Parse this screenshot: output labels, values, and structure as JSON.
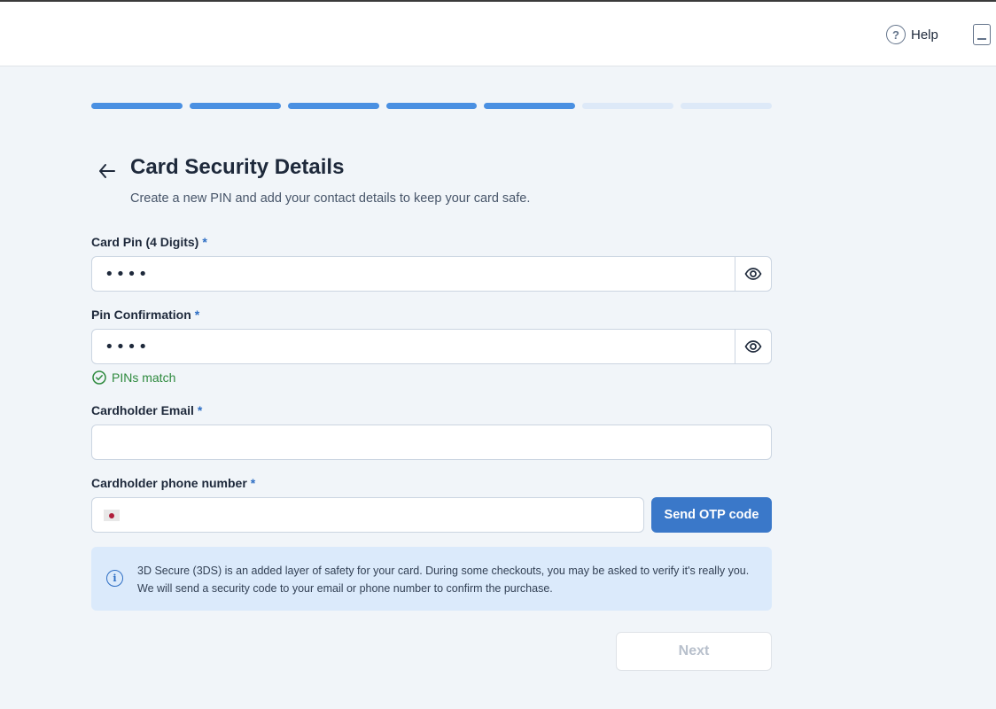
{
  "header": {
    "help_label": "Help",
    "help_icon": "question-circle-icon",
    "panel_icon": "sidebar-panel-icon"
  },
  "progress": {
    "total_steps": 7,
    "completed_steps": 5,
    "done_color": "#4a90e2",
    "todo_color": "#dde9f8"
  },
  "page": {
    "title": "Card Security Details",
    "subtitle": "Create a new PIN and add your contact details to keep your card safe."
  },
  "form": {
    "required_mark": "*",
    "card_pin": {
      "label": "Card Pin (4 Digits)",
      "value": "1234"
    },
    "pin_confirmation": {
      "label": "Pin Confirmation",
      "value": "1234"
    },
    "match_message": "PINs match",
    "email": {
      "label": "Cardholder Email",
      "value": ""
    },
    "phone": {
      "label": "Cardholder phone number",
      "value": "",
      "country_flag": "japan-flag-icon"
    },
    "send_otp_label": "Send OTP code"
  },
  "info": {
    "text": "3D Secure (3DS) is an added layer of safety for your card. During some checkouts, you may be asked to verify it's really you. We will send a security code to your email or phone number to confirm the purchase."
  },
  "footer": {
    "next_label": "Next",
    "next_disabled": true
  },
  "colors": {
    "accent": "#3a78c9",
    "success": "#2e8a3e",
    "info_bg": "#dbeafb"
  }
}
